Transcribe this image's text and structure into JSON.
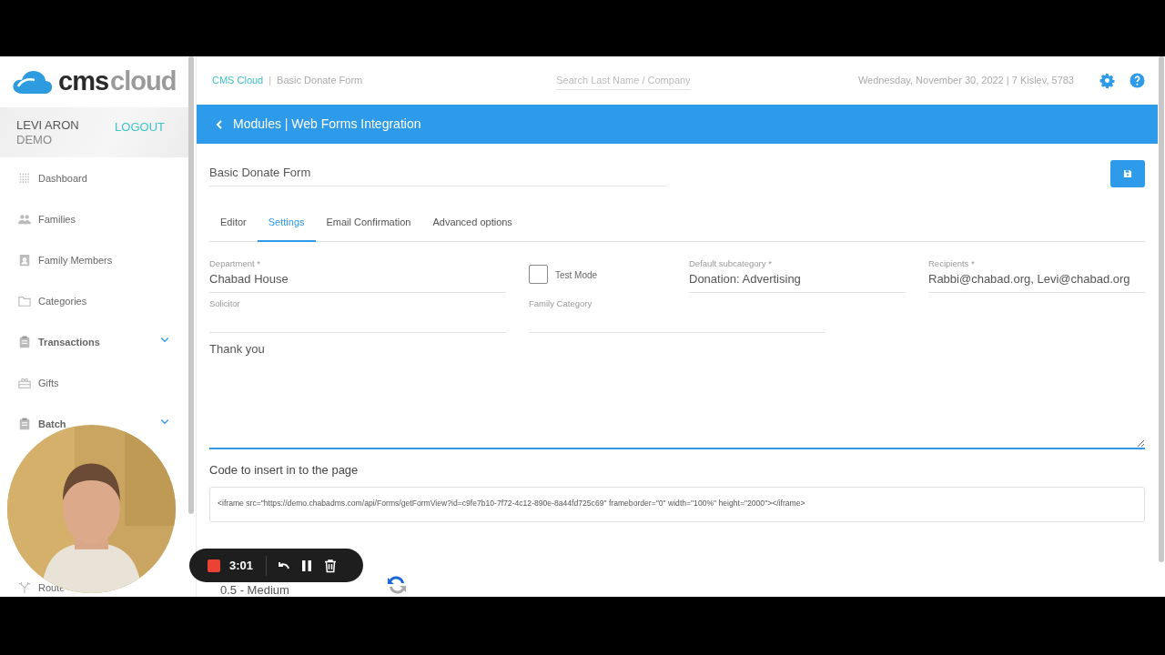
{
  "logo": {
    "strong": "cms",
    "light": "cloud"
  },
  "user": {
    "name": "LEVI ARON",
    "org": "DEMO",
    "logout": "LOGOUT"
  },
  "sidebar": {
    "items": [
      {
        "label": "Dashboard",
        "bold": false,
        "expandable": false
      },
      {
        "label": "Families",
        "bold": false,
        "expandable": false
      },
      {
        "label": "Family Members",
        "bold": false,
        "expandable": false
      },
      {
        "label": "Categories",
        "bold": false,
        "expandable": false
      },
      {
        "label": "Transactions",
        "bold": true,
        "expandable": true
      },
      {
        "label": "Gifts",
        "bold": false,
        "expandable": false
      },
      {
        "label": "Batch",
        "bold": true,
        "expandable": true
      }
    ],
    "lower_items": [
      {
        "label": "Route",
        "bold": false,
        "expandable": false
      }
    ]
  },
  "header": {
    "breadcrumb": [
      {
        "label": "CMS Cloud",
        "link": true
      },
      {
        "label": "Basic Donate Form",
        "link": false
      }
    ],
    "separator": "|",
    "search": {
      "placeholder": "Search Last Name / Company"
    },
    "date": "Wednesday, November 30, 2022 | 7 Kislev, 5783"
  },
  "module_bar": {
    "title": "Modules | Web Forms Integration"
  },
  "form": {
    "name": "Basic Donate Form"
  },
  "tabs": [
    {
      "label": "Editor",
      "selected": false
    },
    {
      "label": "Settings",
      "selected": true
    },
    {
      "label": "Email Confirmation",
      "selected": false
    },
    {
      "label": "Advanced options",
      "selected": false
    }
  ],
  "field_rows": [
    [
      {
        "kind": "field",
        "label": "Department *",
        "value": "Chabad House"
      },
      {
        "kind": "checkbox",
        "label": "Test Mode",
        "checked": false
      },
      {
        "kind": "field",
        "label": "Default subcategory *",
        "value": "Donation: Advertising"
      },
      {
        "kind": "field",
        "label": "Recipients *",
        "value": "Rabbi@chabad.org, Levi@chabad.org"
      }
    ],
    [
      {
        "kind": "field",
        "label": "Solicitor"
      },
      {
        "kind": "field",
        "label": "Family Category"
      }
    ]
  ],
  "message": {
    "value": "Thank you"
  },
  "code_section": {
    "title": "Code to insert in to the page",
    "code": "<iframe src=\"https://demo.chabadms.com/api/Forms/getFormView?id=c9fe7b10-7f72-4c12-890e-8a44fd725c69\" frameborder=\"0\" width=\"100%\" height=\"2000\"></iframe>"
  },
  "threshold": {
    "value": "0.5 - Medium"
  },
  "recorder": {
    "time": "3:01"
  }
}
